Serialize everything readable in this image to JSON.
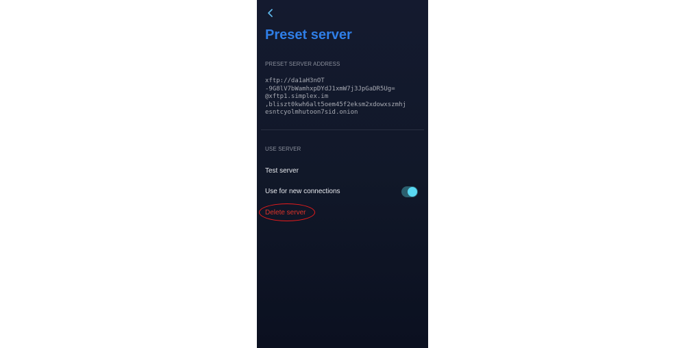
{
  "header": {
    "back_icon": "chevron-left-icon",
    "title": "Preset server"
  },
  "address_section": {
    "label": "PRESET SERVER ADDRESS",
    "lines": [
      "xftp://da1aH3nOT",
      "-9G8lV7bWamhxpDYdJ1xmW7j3JpGaDR5Ug=",
      "@xftp1.simplex.im",
      ",bliszt0kwh6alt5oem45f2eksm2xdowxszmhj",
      "esntcyolmhutoon7sid.onion"
    ]
  },
  "use_section": {
    "label": "USE SERVER",
    "test_label": "Test server",
    "new_connections_label": "Use for new connections",
    "new_connections_enabled": true,
    "delete_label": "Delete server"
  },
  "colors": {
    "title": "#2f7ee6",
    "toggle_on": "#59d8f2",
    "delete": "#e0342a",
    "highlight_annotation": "#ee1b1b"
  }
}
